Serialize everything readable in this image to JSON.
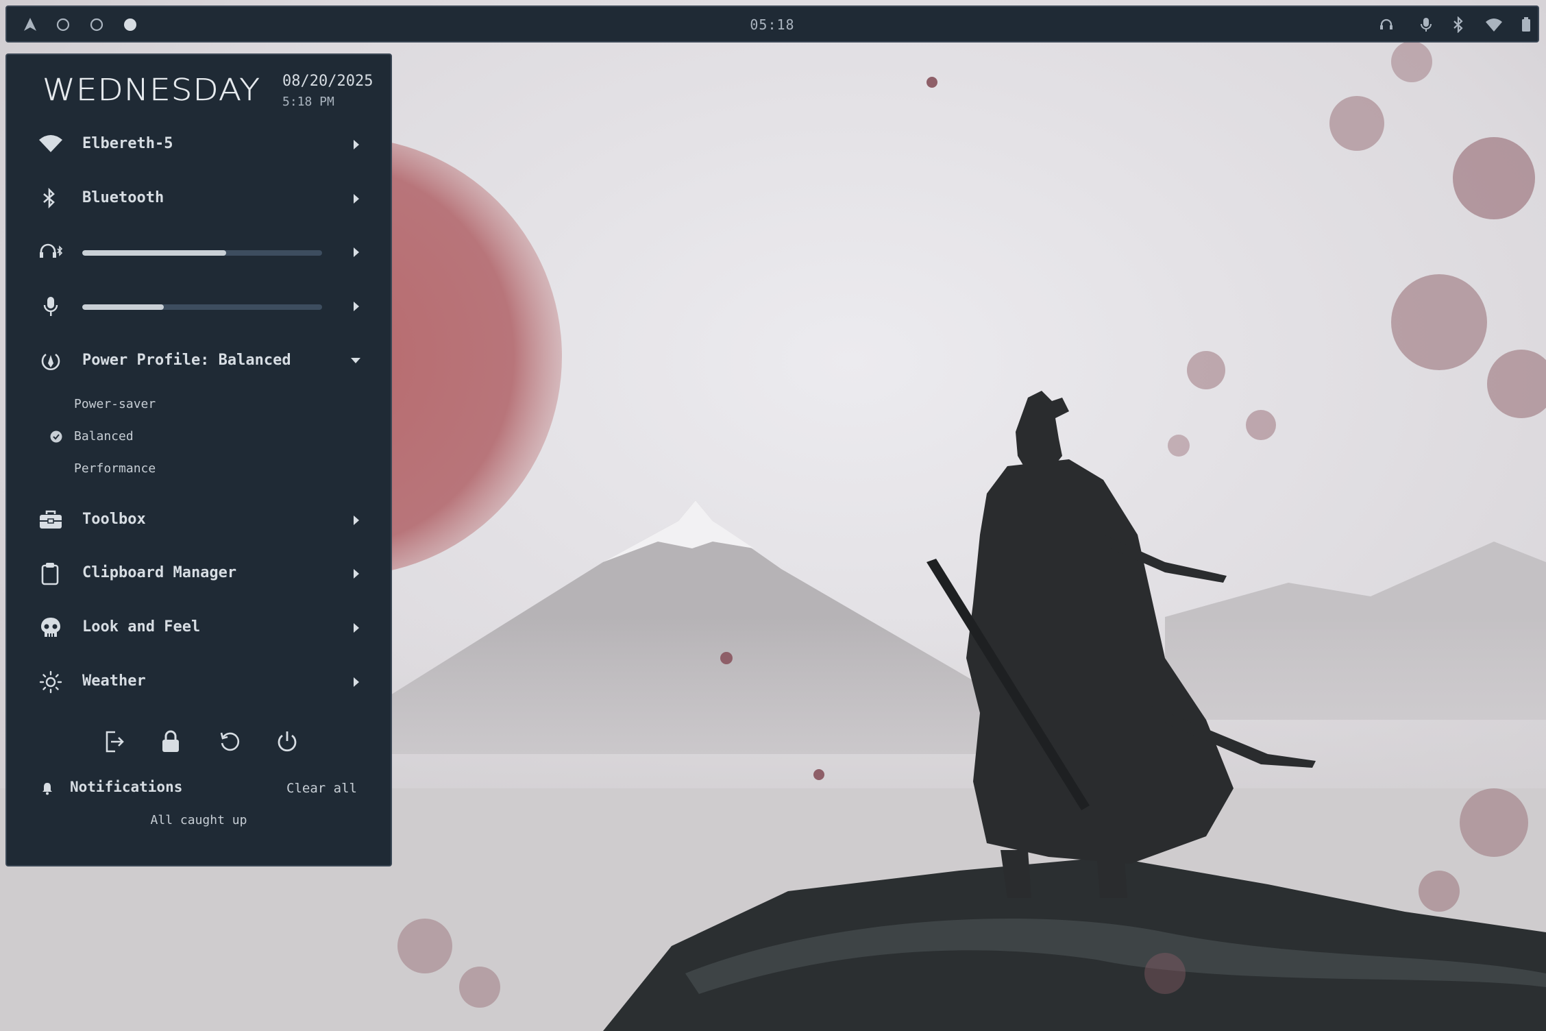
{
  "topbar": {
    "workspaces": [
      {
        "name": "workspace-arch",
        "icon": "arch-logo-icon"
      },
      {
        "name": "workspace-2",
        "icon": "circle-outline-icon"
      },
      {
        "name": "workspace-3",
        "icon": "circle-outline-icon"
      },
      {
        "name": "workspace-4-active",
        "icon": "circle-filled-icon"
      }
    ],
    "clock": "05:18",
    "tray_icons": [
      "headphones-bluetooth-icon",
      "microphone-icon",
      "bluetooth-icon",
      "wifi-icon",
      "battery-icon"
    ]
  },
  "panel": {
    "logo_text": "WEDNESDAY",
    "date": "08/20/2025",
    "time": "5:18 PM",
    "wifi": {
      "label": "Elbereth-5",
      "icon": "wifi-icon"
    },
    "bluetooth": {
      "label": "Bluetooth",
      "icon": "bluetooth-icon"
    },
    "volume": {
      "icon": "headphones-bluetooth-icon",
      "level": 0.6
    },
    "microphone": {
      "icon": "microphone-icon",
      "level": 0.34
    },
    "power_profile": {
      "label": "Power Profile: Balanced",
      "icon": "power-profile-icon",
      "options": [
        "Power-saver",
        "Balanced",
        "Performance"
      ],
      "selected": "Balanced"
    },
    "toolbox": {
      "label": "Toolbox",
      "icon": "toolbox-icon"
    },
    "clipboard": {
      "label": "Clipboard Manager",
      "icon": "clipboard-icon"
    },
    "look_and_feel": {
      "label": "Look and Feel",
      "icon": "skull-icon"
    },
    "weather": {
      "label": "Weather",
      "icon": "sun-icon"
    },
    "session_actions": [
      "logout-icon",
      "lock-icon",
      "restart-icon",
      "power-icon"
    ],
    "notifications": {
      "title": "Notifications",
      "clear_label": "Clear all",
      "empty_text": "All caught up"
    }
  },
  "colors": {
    "panel_bg": "#1f2a35",
    "panel_border": "#3a4654",
    "text": "#d7dde3",
    "slider_track": "#3d4d5f",
    "slider_fill": "#c9d0d6",
    "sun_red": "#b86a6d",
    "blossom": "#8e5f68"
  }
}
